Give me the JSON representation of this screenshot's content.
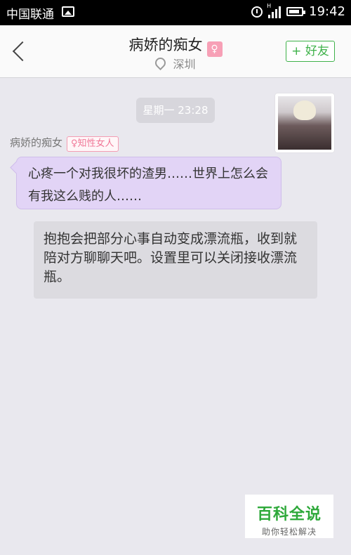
{
  "status_bar": {
    "carrier": "中国联通",
    "network": "H",
    "time": "19:42"
  },
  "header": {
    "title": "病娇的痴女",
    "gender_icon": "female-icon",
    "location": "深圳",
    "add_friend_label": "+ 好友"
  },
  "chat": {
    "timestamp": "星期一 23:28",
    "sender_name": "病娇的痴女",
    "sender_tag": "♀知性女人",
    "incoming_message": "心疼一个对我很坏的渣男……世界上怎么会有我这么贱的人……",
    "system_message": "抱抱会把部分心事自动变成漂流瓶，收到就陪对方聊聊天吧。设置里可以关闭接收漂流瓶。"
  },
  "watermark": {
    "title": "百科全说",
    "subtitle": "助你轻松解决"
  },
  "colors": {
    "accent_green": "#3fb24a",
    "bubble_purple": "#e2d4f6",
    "female_pink": "#f7a0b6"
  }
}
